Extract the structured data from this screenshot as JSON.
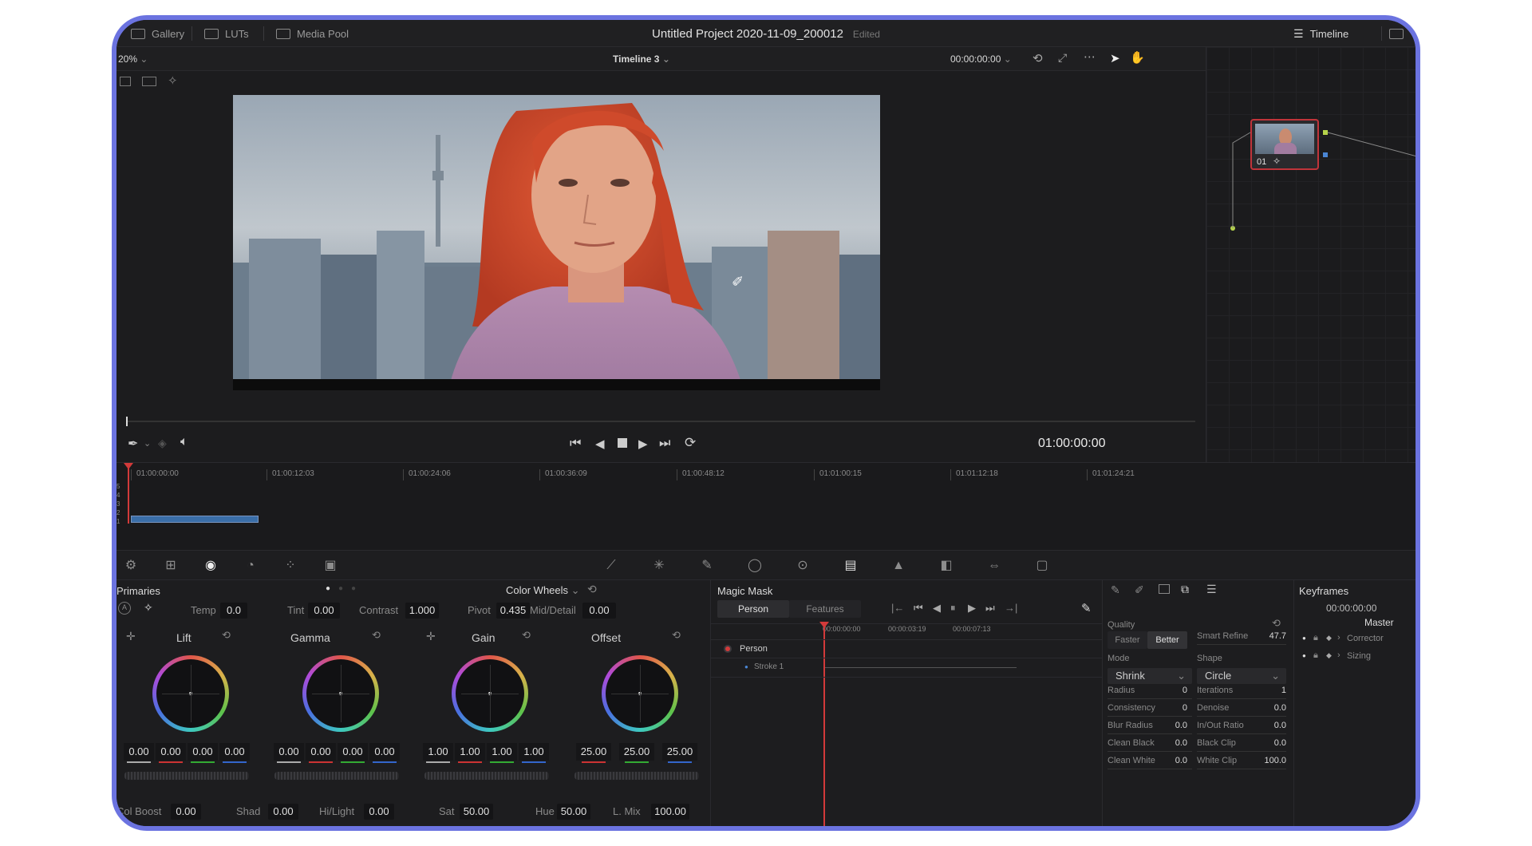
{
  "topbar": {
    "tabs": [
      {
        "label": "Gallery",
        "icon": "gallery-icon"
      },
      {
        "label": "LUTs",
        "icon": "luts-icon"
      },
      {
        "label": "Media Pool",
        "icon": "media-pool-icon"
      }
    ],
    "project_title": "Untitled Project 2020-11-09_200012",
    "status": "Edited",
    "right_tab": "Timeline"
  },
  "viewer": {
    "zoom": "20%",
    "timeline_name": "Timeline 3",
    "timecode_top": "00:00:00:00",
    "timecode_main": "01:00:00:00"
  },
  "node_graph": {
    "node_label": "01"
  },
  "mini_timeline": {
    "timecodes": [
      "01:00:00:00",
      "01:00:12:03",
      "01:00:24:06",
      "01:00:36:09",
      "01:00:48:12",
      "01:01:00:15",
      "01:01:12:18",
      "01:01:24:21"
    ],
    "tracks": [
      "5",
      "4",
      "3",
      "2",
      "1"
    ]
  },
  "primaries": {
    "title": "Primaries",
    "mode": "Color Wheels",
    "adjust": {
      "temp_label": "Temp",
      "temp": "0.0",
      "tint_label": "Tint",
      "tint": "0.00",
      "contrast_label": "Contrast",
      "contrast": "1.000",
      "pivot_label": "Pivot",
      "pivot": "0.435",
      "middetail_label": "Mid/Detail",
      "middetail": "0.00"
    },
    "wheels": [
      {
        "name": "Lift",
        "values": [
          "0.00",
          "0.00",
          "0.00",
          "0.00"
        ]
      },
      {
        "name": "Gamma",
        "values": [
          "0.00",
          "0.00",
          "0.00",
          "0.00"
        ]
      },
      {
        "name": "Gain",
        "values": [
          "1.00",
          "1.00",
          "1.00",
          "1.00"
        ]
      },
      {
        "name": "Offset",
        "values": [
          "25.00",
          "25.00",
          "25.00"
        ]
      }
    ],
    "bottom": {
      "colboost_label": "Col Boost",
      "colboost": "0.00",
      "shad_label": "Shad",
      "shad": "0.00",
      "hilight_label": "Hi/Light",
      "hilight": "0.00",
      "sat_label": "Sat",
      "sat": "50.00",
      "hue_label": "Hue",
      "hue": "50.00",
      "lmix_label": "L. Mix",
      "lmix": "100.00"
    }
  },
  "magic_mask": {
    "title": "Magic Mask",
    "tabs": [
      "Person",
      "Features"
    ],
    "timecodes": [
      "00:00:00:00",
      "00:00:03:19",
      "00:00:07:13"
    ],
    "tracks": [
      "Person",
      "Stroke 1"
    ]
  },
  "mask_settings": {
    "quality_label": "Quality",
    "quality_options": [
      "Faster",
      "Better"
    ],
    "smart_refine_label": "Smart Refine",
    "smart_refine": "47.7",
    "mode_label": "Mode",
    "mode": "Shrink",
    "shape_label": "Shape",
    "shape": "Circle",
    "radius_label": "Radius",
    "radius": "0",
    "iterations_label": "Iterations",
    "iterations": "1",
    "consistency_label": "Consistency",
    "consistency": "0",
    "denoise_label": "Denoise",
    "denoise": "0.0",
    "blur_radius_label": "Blur Radius",
    "blur_radius": "0.0",
    "inout_ratio_label": "In/Out Ratio",
    "inout_ratio": "0.0",
    "clean_black_label": "Clean Black",
    "clean_black": "0.0",
    "black_clip_label": "Black Clip",
    "black_clip": "0.0",
    "clean_white_label": "Clean White",
    "clean_white": "0.0",
    "white_clip_label": "White Clip",
    "white_clip": "100.0"
  },
  "keyframes": {
    "title": "Keyframes",
    "timecode": "00:00:00:00",
    "master": "Master",
    "rows": [
      "Corrector",
      "Sizing"
    ]
  },
  "colors": {
    "frame_border": "#6b73e0",
    "playhead": "#d23a3a",
    "accent_blue": "#3a6ea8"
  }
}
